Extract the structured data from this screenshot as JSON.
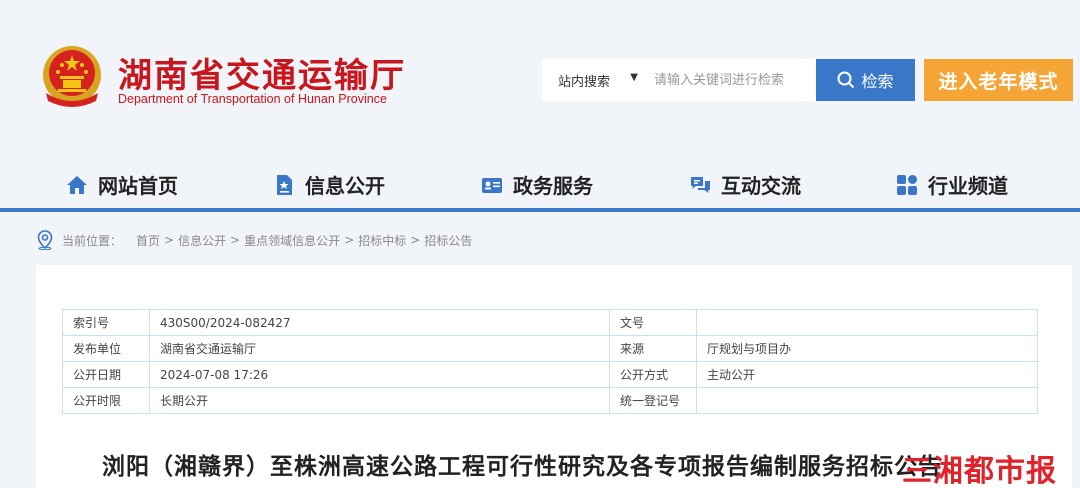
{
  "header": {
    "title": "湖南省交通运输厅",
    "subtitle": "Department of Transportation of Hunan Province",
    "emblem_icon": "national-emblem-icon"
  },
  "search": {
    "scope": "站内搜索",
    "placeholder": "请输入关键词进行检索",
    "button_label": "检索"
  },
  "elder_mode_label": "进入老年模式",
  "nav": {
    "items": [
      {
        "label": "网站首页",
        "icon": "home-icon"
      },
      {
        "label": "信息公开",
        "icon": "document-icon"
      },
      {
        "label": "政务服务",
        "icon": "id-card-icon"
      },
      {
        "label": "互动交流",
        "icon": "chat-icon"
      },
      {
        "label": "行业频道",
        "icon": "grid-icon"
      }
    ]
  },
  "breadcrumb": {
    "label": "当前位置：",
    "items": [
      "首页",
      "信息公开",
      "重点领域信息公开",
      "招标中标",
      "招标公告"
    ],
    "separator": ">"
  },
  "meta_table": {
    "rows": [
      {
        "k1": "索引号",
        "v1": "430S00/2024-082427",
        "k2": "文号",
        "v2": ""
      },
      {
        "k1": "发布单位",
        "v1": "湖南省交通运输厅",
        "k2": "来源",
        "v2": "厅规划与项目办"
      },
      {
        "k1": "公开日期",
        "v1": "2024-07-08 17:26",
        "k2": "公开方式",
        "v2": "主动公开"
      },
      {
        "k1": "公开时限",
        "v1": "长期公开",
        "k2": "统一登记号",
        "v2": ""
      }
    ]
  },
  "article": {
    "title": "浏阳（湘赣界）至株洲高速公路工程可行性研究及各专项报告编制服务招标公告"
  },
  "watermark": "三湘都市报",
  "colors": {
    "brand_red": "#c8161d",
    "accent_blue": "#3a77c9",
    "elder_orange": "#f4a536",
    "table_border": "#c9dff2"
  }
}
